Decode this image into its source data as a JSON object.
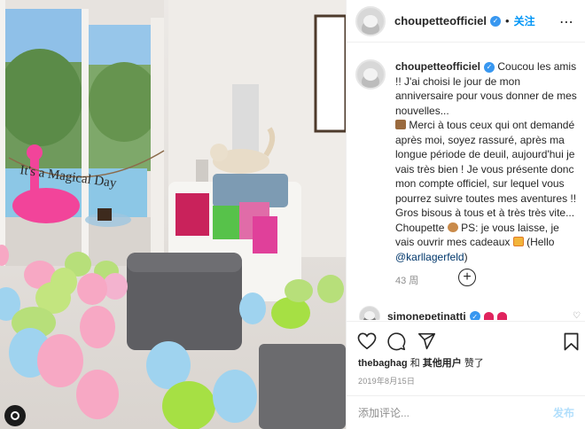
{
  "header": {
    "username": "choupetteofficiel",
    "follow_label": "关注"
  },
  "caption": {
    "username": "choupetteofficiel",
    "part1": "Coucou les amis !! J'ai choisi le jour de mon anniversaire pour vous donner de mes nouvelles...",
    "part2": "Merci à tous ceux qui ont demandé après moi, soyez rassuré, après ma longue période de deuil, aujourd'hui je vais très bien ! Je vous présente donc mon compte officiel, sur lequel vous pourrez suivre toutes mes aventures !! Gros bisous à tous et à très très vite... Choupette",
    "part3": "PS: je vous laisse, je vais ouvrir mes cadeaux",
    "part4": "(Hello",
    "mention": "@karllagerfeld",
    "part5": ")",
    "time_ago": "43 周",
    "emoji_names": [
      "package-emoji",
      "paw-emoji",
      "gift-emoji"
    ]
  },
  "second_comment": {
    "username": "simonepetinatti"
  },
  "likes": {
    "user": "thebaghag",
    "joiner": "和",
    "others": "其他用户",
    "suffix": "赞了"
  },
  "date": "2019年8月15日",
  "compose": {
    "placeholder": "添加评论...",
    "post_label": "发布"
  },
  "photo": {
    "banner_text": "It's a Magical Day",
    "balloon_colors": [
      "#f7a8c4",
      "#b7df7a",
      "#9fd3ef",
      "#f3b3cf"
    ],
    "description_icons": [
      "cat-icon",
      "gift-bags-icon",
      "flamingo-float-icon",
      "pouf-icon",
      "chair-icon"
    ]
  },
  "colors": {
    "accent": "#0095f6",
    "verified": "#3897f0",
    "muted": "#8e8e8e"
  }
}
